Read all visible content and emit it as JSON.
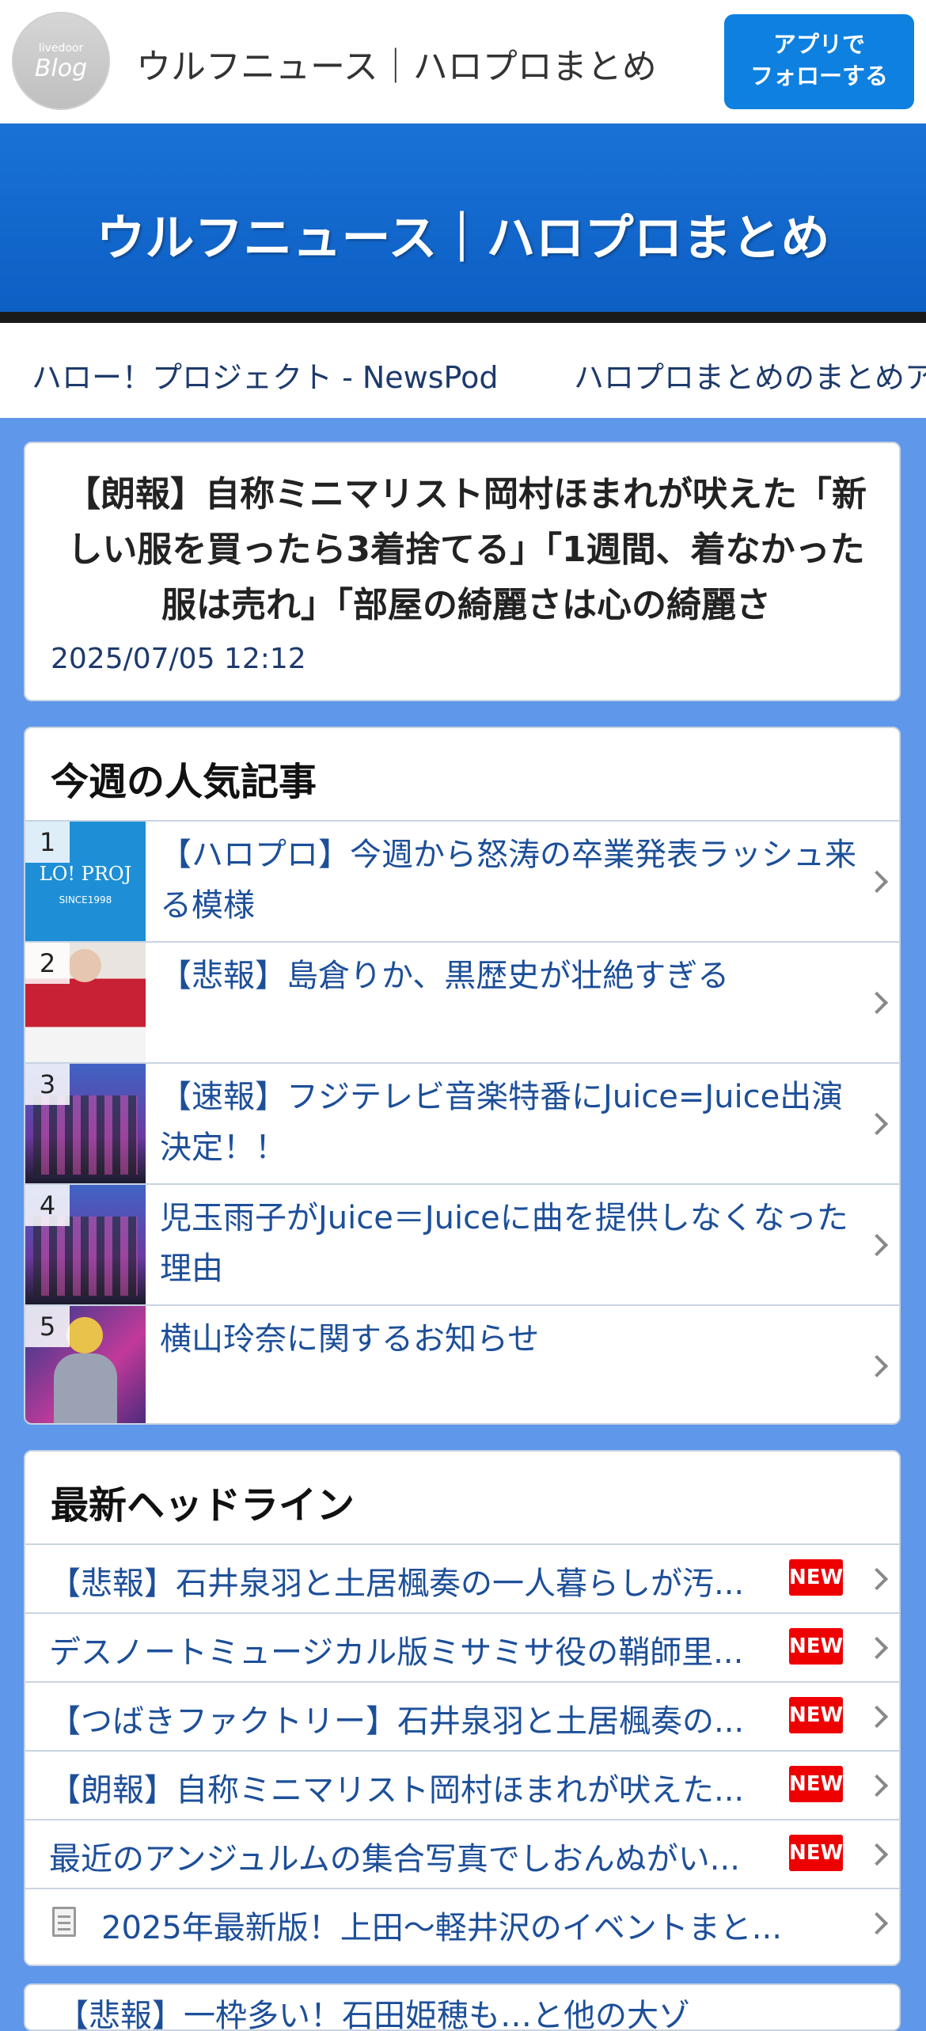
{
  "topbar": {
    "logo_small": "livedoor",
    "logo_big": "Blog",
    "site_name": "ウルフニュース｜ハロプロまとめ",
    "follow_button": [
      "アプリで",
      "フォローする"
    ]
  },
  "banner": {
    "title": "ウルフニュース｜ハロプロまとめ"
  },
  "nav": {
    "items": [
      "ハロー！プロジェクト - NewsPod",
      "ハロプロまとめのまとめア"
    ]
  },
  "article": {
    "title": "【朗報】自称ミニマリスト岡村ほまれが吠えた「新しい服を買ったら3着捨てる」「1週間、着なかった服は売れ」「部屋の綺麗さは心の綺麗さ",
    "date": "2025/07/05 12:12"
  },
  "ranking": {
    "title": "今週の人気記事",
    "items": [
      {
        "rank": "1",
        "label": "【ハロプロ】今週から怒涛の卒業発表ラッシュ来る模様",
        "thumb_text": "LO! PROJ",
        "thumb_sub": "SINCE1998"
      },
      {
        "rank": "2",
        "label": "【悲報】島倉りか、黒歴史が壮絶すぎる"
      },
      {
        "rank": "3",
        "label": "【速報】フジテレビ音楽特番にJuice=Juice出演決定！！"
      },
      {
        "rank": "4",
        "label": "児玉雨子がJuice＝Juiceに曲を提供しなくなった理由"
      },
      {
        "rank": "5",
        "label": "横山玲奈に関するお知らせ"
      }
    ]
  },
  "headlines": {
    "title": "最新ヘッドライン",
    "new_label": "NEW",
    "items": [
      {
        "label": "【悲報】石井泉羽と土居楓奏の一人暮らしが汚...",
        "new": true
      },
      {
        "label": "デスノートミュージカル版ミサミサ役の鞘師里...",
        "new": true
      },
      {
        "label": "【つばきファクトリー】石井泉羽と土居楓奏の...",
        "new": true
      },
      {
        "label": "【朗報】自称ミニマリスト岡村ほまれが吠えた...",
        "new": true
      },
      {
        "label": "最近のアンジュルムの集合写真でしおんぬがい...",
        "new": true
      },
      {
        "label": "2025年最新版！上田〜軽井沢のイベントまと...",
        "new": false
      }
    ]
  },
  "next_card": {
    "label": "【悲報】一枠多い！石田姫穂も…と他の大ゾ"
  },
  "colors": {
    "page_bg": "#5f97ea",
    "banner": "#1a72d6",
    "link": "#1d4f99",
    "new_badge": "#ee0000",
    "follow_btn": "#0d80e0"
  }
}
